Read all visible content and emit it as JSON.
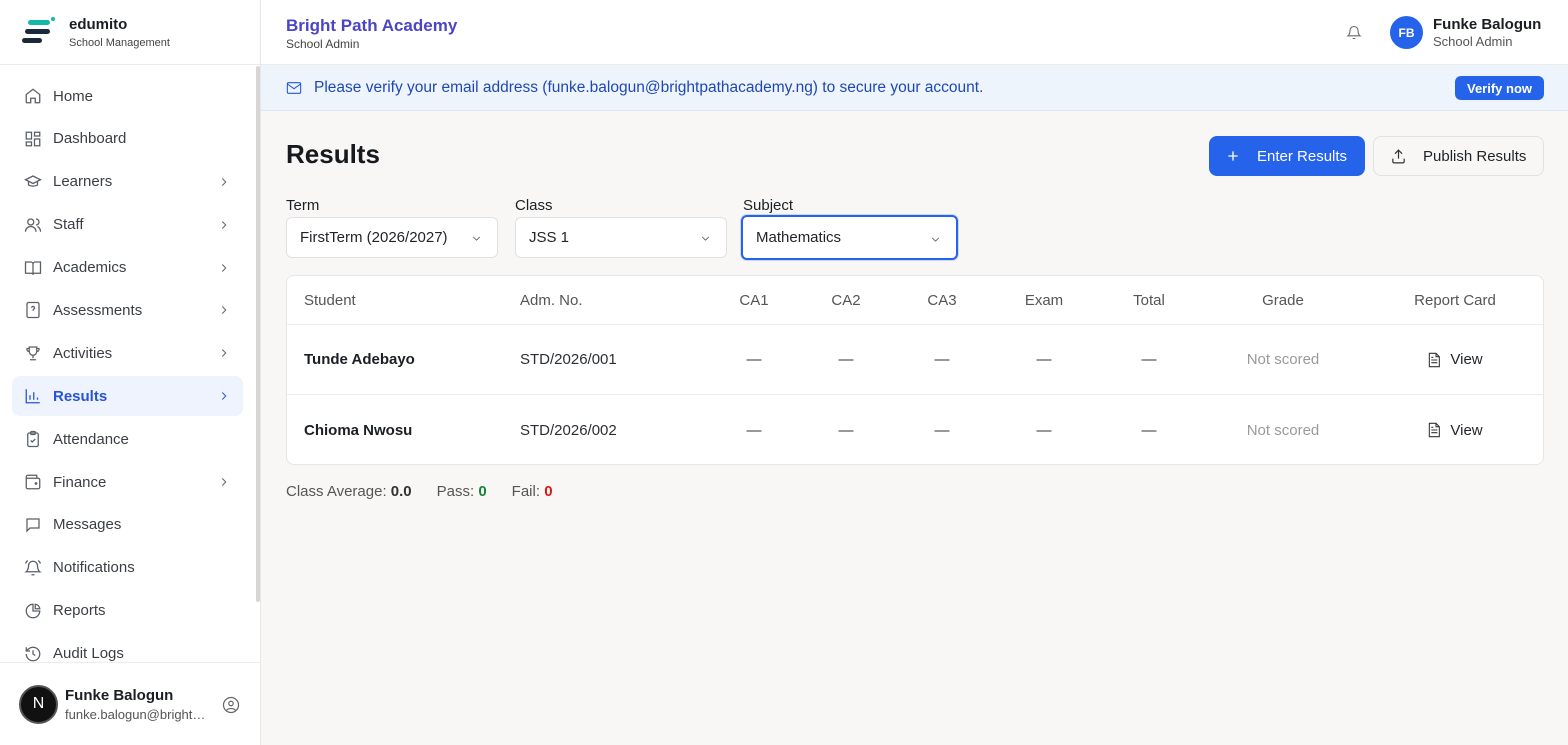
{
  "brand": {
    "name": "edumito",
    "subtitle": "School Management"
  },
  "sidebar": {
    "items": [
      {
        "label": "Home",
        "icon": "home-icon",
        "chevron": false,
        "active": false
      },
      {
        "label": "Dashboard",
        "icon": "dashboard-icon",
        "chevron": false,
        "active": false
      },
      {
        "label": "Learners",
        "icon": "graduation-cap-icon",
        "chevron": true,
        "active": false
      },
      {
        "label": "Staff",
        "icon": "users-icon",
        "chevron": true,
        "active": false
      },
      {
        "label": "Academics",
        "icon": "book-icon",
        "chevron": true,
        "active": false
      },
      {
        "label": "Assessments",
        "icon": "file-question-icon",
        "chevron": true,
        "active": false
      },
      {
        "label": "Activities",
        "icon": "trophy-icon",
        "chevron": true,
        "active": false
      },
      {
        "label": "Results",
        "icon": "bar-chart-icon",
        "chevron": true,
        "active": true
      },
      {
        "label": "Attendance",
        "icon": "clipboard-check-icon",
        "chevron": false,
        "active": false
      },
      {
        "label": "Finance",
        "icon": "wallet-icon",
        "chevron": true,
        "active": false
      },
      {
        "label": "Messages",
        "icon": "message-icon",
        "chevron": false,
        "active": false
      },
      {
        "label": "Notifications",
        "icon": "bell-ring-icon",
        "chevron": false,
        "active": false
      },
      {
        "label": "Reports",
        "icon": "pie-chart-icon",
        "chevron": false,
        "active": false
      },
      {
        "label": "Audit Logs",
        "icon": "history-icon",
        "chevron": false,
        "active": false
      }
    ],
    "user": {
      "initial": "N",
      "name": "Funke Balogun",
      "email": "funke.balogun@brightpathacademy.ng"
    }
  },
  "header": {
    "school_name": "Bright Path Academy",
    "school_role": "School Admin",
    "user_initials": "FB",
    "user_name": "Funke Balogun",
    "user_role": "School Admin"
  },
  "banner": {
    "text": "Please verify your email address (funke.balogun@brightpathacademy.ng) to secure your account.",
    "button": "Verify now"
  },
  "main": {
    "title": "Results",
    "enter_button": "Enter Results",
    "publish_button": "Publish Results",
    "filters": {
      "term_label": "Term",
      "term_value": "FirstTerm (2026/2027)",
      "class_label": "Class",
      "class_value": "JSS 1",
      "subject_label": "Subject",
      "subject_value": "Mathematics"
    },
    "table": {
      "columns": [
        "Student",
        "Adm. No.",
        "CA1",
        "CA2",
        "CA3",
        "Exam",
        "Total",
        "Grade",
        "Report Card"
      ],
      "rows": [
        {
          "student": "Tunde Adebayo",
          "adm_no": "STD/2026/001",
          "ca1": "—",
          "ca2": "—",
          "ca3": "—",
          "exam": "—",
          "total": "—",
          "grade": "Not scored",
          "report": "View"
        },
        {
          "student": "Chioma Nwosu",
          "adm_no": "STD/2026/002",
          "ca1": "—",
          "ca2": "—",
          "ca3": "—",
          "exam": "—",
          "total": "—",
          "grade": "Not scored",
          "report": "View"
        }
      ]
    },
    "stats": {
      "avg_label": "Class Average:",
      "avg_value": "0.0",
      "pass_label": "Pass:",
      "pass_value": "0",
      "fail_label": "Fail:",
      "fail_value": "0"
    }
  },
  "colors": {
    "accent": "#2563eb",
    "school_name": "#4b45c6",
    "pass": "#14843b",
    "fail": "#d11a1a"
  }
}
